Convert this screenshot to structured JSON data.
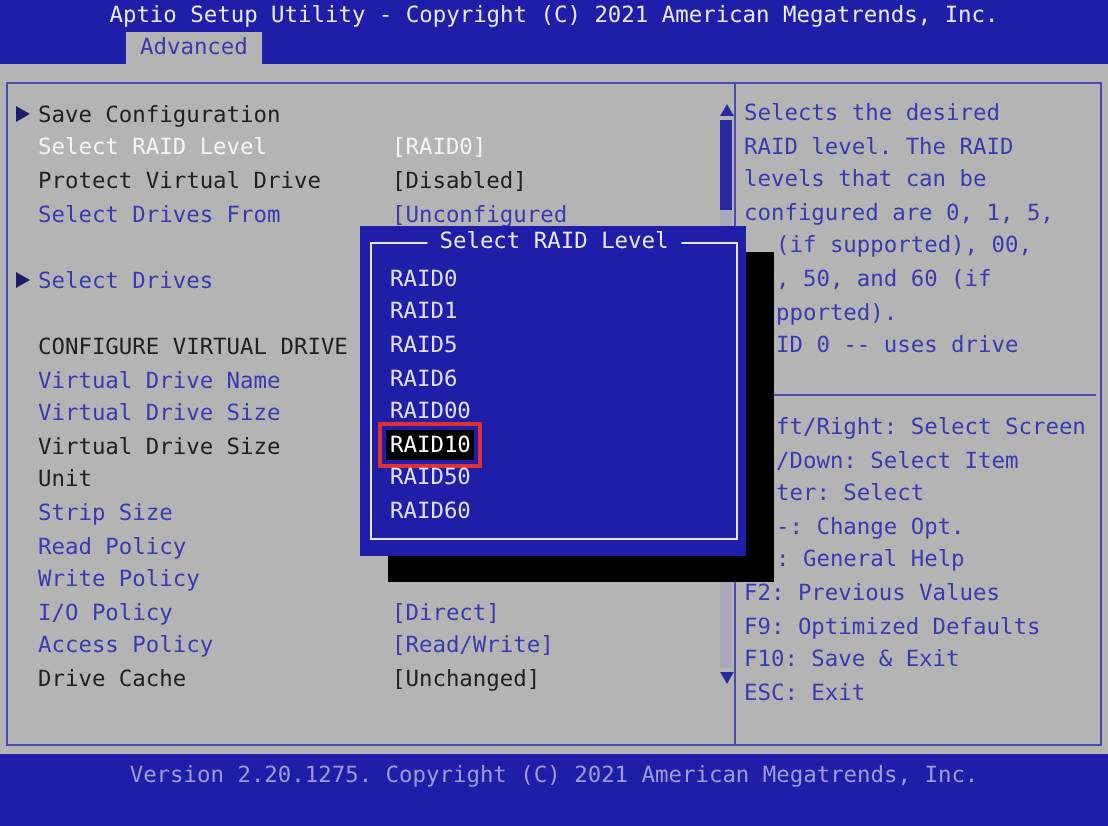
{
  "header": {
    "title": "Aptio Setup Utility - Copyright (C) 2021 American Megatrends, Inc.",
    "tabs": [
      {
        "label": "Advanced",
        "selected": true
      }
    ]
  },
  "settings": [
    {
      "kind": "submenu",
      "label": "Save Configuration",
      "editable": false,
      "selected": false
    },
    {
      "kind": "setting",
      "label": "Select RAID Level",
      "value": "[RAID0]",
      "editable": true,
      "selected": true
    },
    {
      "kind": "setting",
      "label": "Protect Virtual Drive",
      "value": "[Disabled]",
      "editable": false,
      "selected": false
    },
    {
      "kind": "setting",
      "label": "Select Drives From",
      "value": "[Unconfigured",
      "editable": true,
      "selected": false
    },
    {
      "kind": "blank"
    },
    {
      "kind": "submenu",
      "label": "Select Drives",
      "editable": true,
      "selected": false
    },
    {
      "kind": "blank"
    },
    {
      "kind": "setting",
      "label": "CONFIGURE VIRTUAL DRIVE",
      "editable": false,
      "selected": false
    },
    {
      "kind": "setting",
      "label": "Virtual Drive Name",
      "editable": true,
      "selected": false
    },
    {
      "kind": "setting",
      "label": "Virtual Drive Size",
      "editable": true,
      "selected": false
    },
    {
      "kind": "setting",
      "label": "Virtual Drive Size",
      "editable": false,
      "selected": false
    },
    {
      "kind": "setting",
      "label": "Unit",
      "editable": false,
      "selected": false
    },
    {
      "kind": "setting",
      "label": "Strip Size",
      "editable": true,
      "selected": false
    },
    {
      "kind": "setting",
      "label": "Read Policy",
      "editable": true,
      "selected": false
    },
    {
      "kind": "setting",
      "label": "Write Policy",
      "editable": true,
      "selected": false
    },
    {
      "kind": "setting",
      "label": "I/O Policy",
      "value": "[Direct]",
      "editable": true,
      "selected": false
    },
    {
      "kind": "setting",
      "label": "Access Policy",
      "value": "[Read/Write]",
      "editable": true,
      "selected": false
    },
    {
      "kind": "setting",
      "label": "Drive Cache",
      "value": "[Unchanged]",
      "editable": false,
      "selected": false
    }
  ],
  "help": [
    {
      "text": "Selects the desired",
      "covered": false
    },
    {
      "text": "RAID level. The RAID",
      "covered": false
    },
    {
      "text": "levels that can be",
      "covered": false
    },
    {
      "text": "configured are 0, 1, 5,",
      "covered": false
    },
    {
      "text": "(if supported), 00,",
      "covered": true
    },
    {
      "text": ", 50, and 60 (if",
      "covered": true
    },
    {
      "text": "pported).",
      "covered": true
    },
    {
      "text": "ID 0 -- uses drive",
      "covered": true
    }
  ],
  "keys": [
    {
      "text": "ft/Right: Select Screen",
      "covered": true
    },
    {
      "text": "/Down: Select Item",
      "covered": true
    },
    {
      "text": "ter: Select",
      "covered": true
    },
    {
      "text": "-: Change Opt.",
      "covered": true
    },
    {
      "text": ": General Help",
      "covered": true
    },
    {
      "text": "F2: Previous Values",
      "covered": false
    },
    {
      "text": "F9: Optimized Defaults",
      "covered": false
    },
    {
      "text": "F10: Save & Exit",
      "covered": false
    },
    {
      "text": "ESC: Exit",
      "covered": false
    }
  ],
  "popup": {
    "title": "Select RAID Level",
    "options": [
      {
        "label": "RAID0",
        "selected": false,
        "highlighted": false
      },
      {
        "label": "RAID1",
        "selected": false,
        "highlighted": false
      },
      {
        "label": "RAID5",
        "selected": false,
        "highlighted": false
      },
      {
        "label": "RAID6",
        "selected": false,
        "highlighted": false
      },
      {
        "label": "RAID00",
        "selected": false,
        "highlighted": false
      },
      {
        "label": "RAID10",
        "selected": true,
        "highlighted": true
      },
      {
        "label": "RAID50",
        "selected": false,
        "highlighted": false
      },
      {
        "label": "RAID60",
        "selected": false,
        "highlighted": false
      }
    ]
  },
  "footer": {
    "text": "Version 2.20.1275. Copyright (C) 2021 American Megatrends, Inc."
  }
}
